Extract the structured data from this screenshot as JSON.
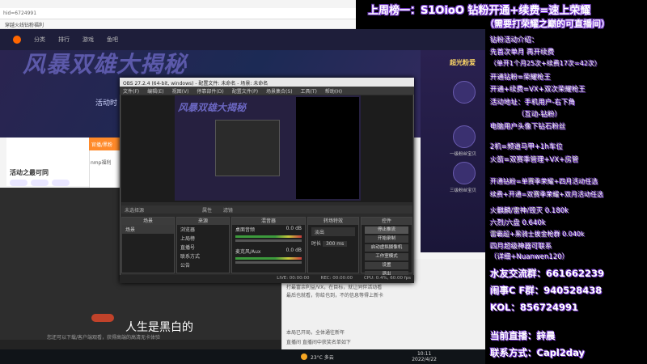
{
  "browser": {
    "address": "hid=6724991",
    "bookmark": "穿越火线钻粉福利",
    "nav": [
      "分类",
      "排行",
      "游戏",
      "鱼吧"
    ],
    "banner_text": "风暴双雄大揭秘",
    "banner_sub": "活动时",
    "room_title": "活动之最可同",
    "popup_header": "官播/黑粉",
    "popup_body": "nmp福利",
    "subtitle": "人生是黑白的",
    "ad_text": "您还可以下载/客户端观看，获得高端的高清无卡体验",
    "chat": [
      "打最富余利益/VX，在目标，就让同伴活动看",
      "最后也就看，你给也到，不的信息等得上新卡",
      "本局已开局，全体通往新年",
      "直播间 直播间中获奖名单如下"
    ],
    "right_badges": [
      "超光粉爱",
      "一级粉丝宝贝",
      "三级粉丝宝贝"
    ]
  },
  "taskbar": {
    "weather": "23°C 多云",
    "time": "10:11",
    "date": "2022/4/22"
  },
  "obs": {
    "title": "OBS 27.2.4 (64-bit, windows) - 配置文件: 未命名 - 场景: 未命名",
    "menu": [
      "文件(F)",
      "编辑(E)",
      "视图(V)",
      "停靠部件(D)",
      "配置文件(P)",
      "场景集合(S)",
      "工具(T)",
      "帮助(H)"
    ],
    "source_bar": "未选择源",
    "source_bar_buttons": [
      "属性",
      "滤镜"
    ],
    "docks": {
      "scenes": {
        "title": "场景",
        "items": [
          "场景"
        ]
      },
      "sources": {
        "title": "来源",
        "items": [
          "浏览器",
          "上局榜",
          "直播号",
          "联系方式",
          "公告"
        ]
      },
      "mixer": {
        "title": "混音器",
        "tracks": [
          {
            "name": "桌面音频",
            "db": "0.0 dB"
          },
          {
            "name": "麦克风/Aux",
            "db": "0.0 dB"
          }
        ]
      },
      "transitions": {
        "title": "转场特效",
        "type": "淡出",
        "duration_label": "时长",
        "duration": "300 ms"
      },
      "controls": {
        "title": "控件",
        "buttons": [
          "停止推流",
          "开始录制",
          "启动虚拟摄像机",
          "工作室模式",
          "设置",
          "退出"
        ]
      }
    },
    "status": [
      "LIVE: 00:00:00",
      "REC: 00:00:00",
      "CPU: 0.4%, 60.00 fps"
    ]
  },
  "overlay": {
    "top_line1": "上周榜一：S1OioO 钻粉开通+续费=速上荣耀",
    "top_line2": "（需要打荣耀之巅的可直播间）",
    "lines": [
      "钻粉活动介绍：",
      "先首次单月 再开续费",
      "（单开1个月25次+续费17次=42次）",
      "开通钻粉=荣耀枪王",
      "开通+续费=VX+双次荣耀枪王",
      "活动地址：手机用户-右下角",
      "（互动-钻粉）",
      "电脑用户头像下钻石粉丝",
      "",
      "2机=频道马甲+1h车位",
      "火箭=双赛季管理+VX+房管",
      "",
      "开通钻粉=单赛季荣耀+四月活动任选",
      "续费+开通=双赛季荣耀+双月活动任选",
      "",
      "火麒麟/雷神/毁灭  0.180k",
      "六烈/六盘  0.640k",
      "雷霸超+黑骑士挨金枪群 0.040k",
      "四月超级神器可联系",
      "（详细+Nuanwen120）"
    ],
    "contacts": [
      "水友交流群：661662239",
      "闹事C F群：940528438",
      "KOL：856724991"
    ],
    "current_label": "当前直播：鋅晨",
    "contact_label": "联系方式：Capl2day"
  }
}
